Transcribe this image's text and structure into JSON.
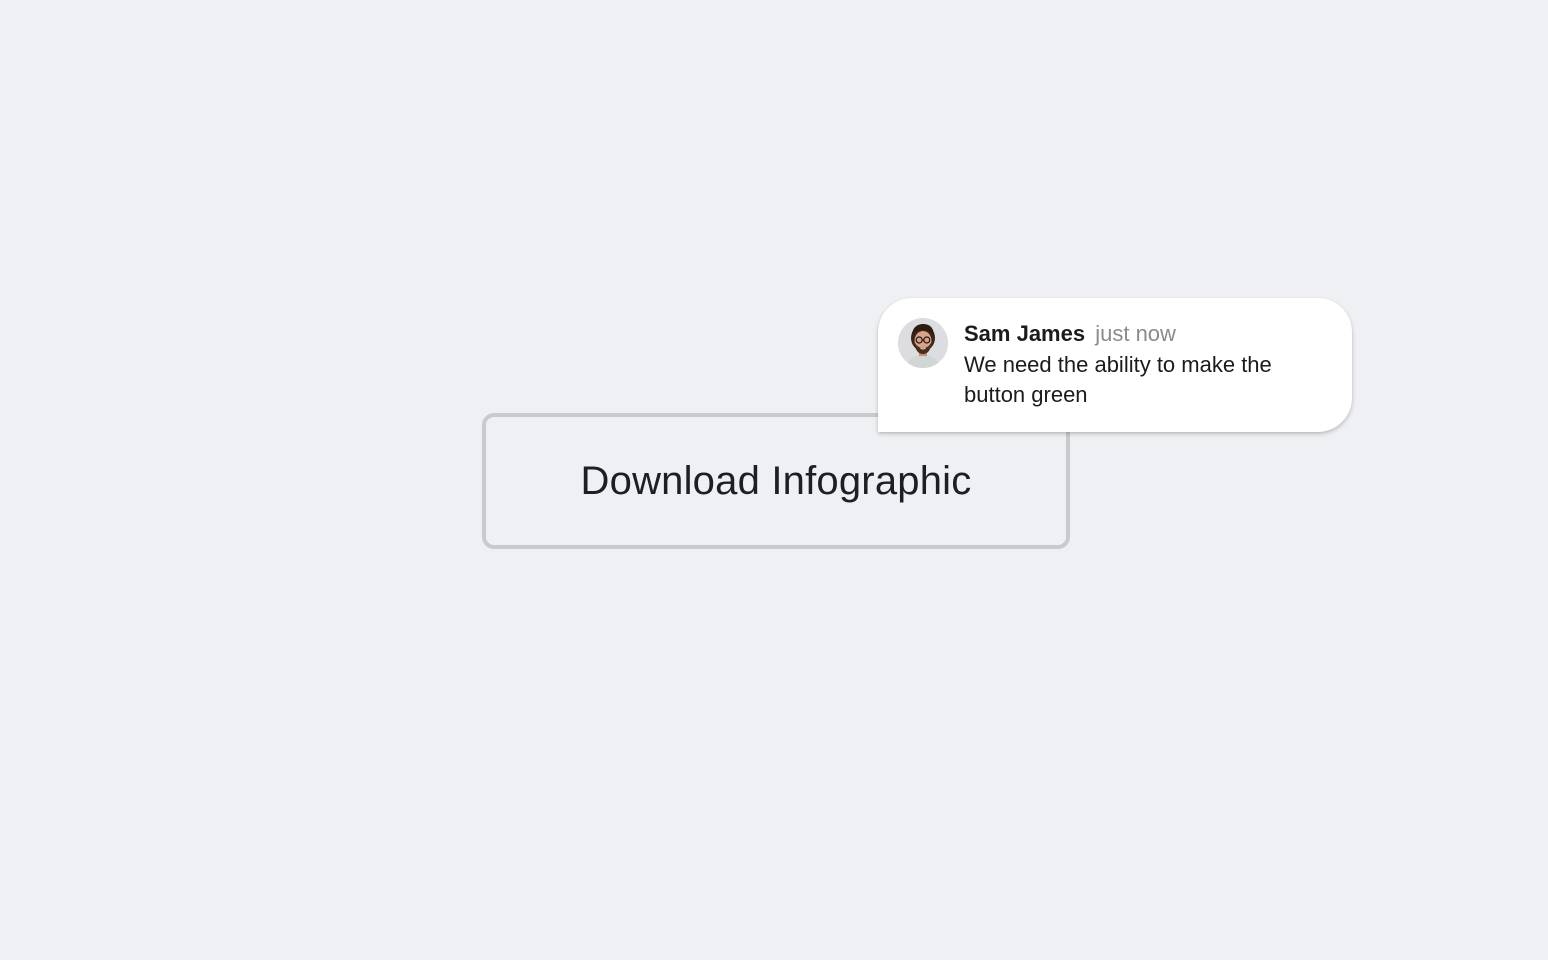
{
  "button": {
    "label": "Download Infographic"
  },
  "comment": {
    "author": "Sam James",
    "timestamp": "just now",
    "text": "We need the ability to make the button green",
    "avatar_icon": "user-avatar"
  },
  "colors": {
    "background": "#eff0f3",
    "button_border": "#c9cacd",
    "text_primary": "#1b1b1d",
    "text_secondary": "#8a8b8e",
    "bubble": "#ffffff"
  }
}
